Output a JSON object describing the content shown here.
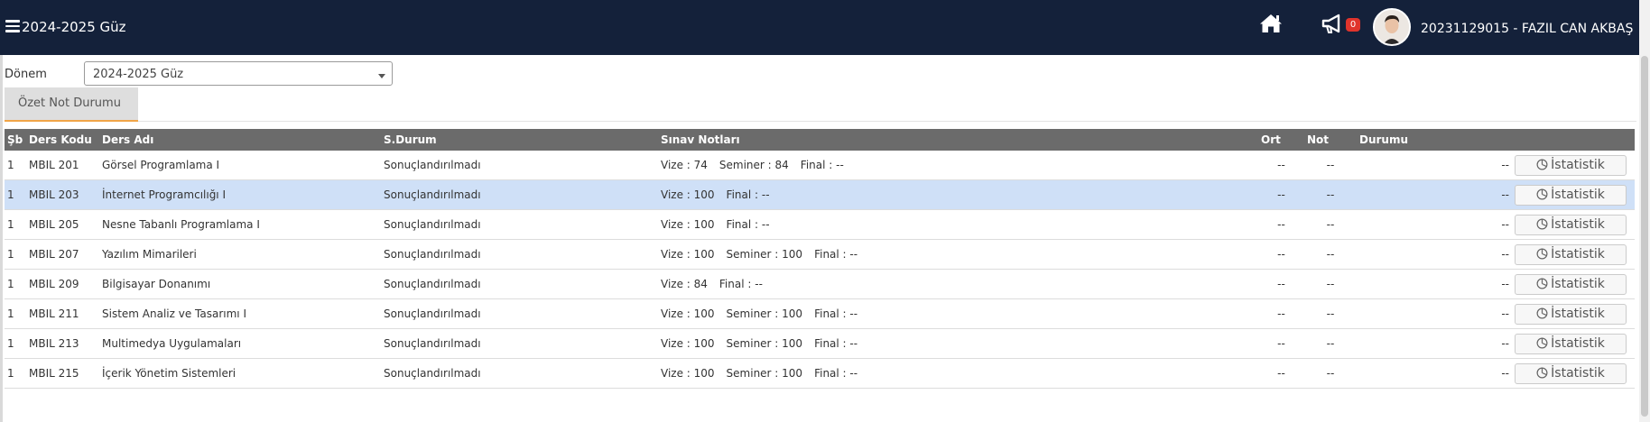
{
  "header": {
    "term": "2024-2025 Güz",
    "notification_count": "0",
    "user": "20231129015 - FAZIL CAN AKBAŞ"
  },
  "filter": {
    "label": "Dönem",
    "value": "2024-2025 Güz"
  },
  "tabs": [
    {
      "label": "Özet Not Durumu"
    }
  ],
  "table": {
    "columns": [
      "Şb",
      "Ders Kodu",
      "Ders Adı",
      "S.Durum",
      "Sınav Notları",
      "Ort",
      "Not",
      "Durumu"
    ],
    "rows": [
      {
        "sb": "1",
        "code": "MBIL 201",
        "name": "Görsel Programlama I",
        "status": "Sonuçlandırılmadı",
        "exams": [
          "Vize : 74",
          "Seminer : 84",
          "Final : --"
        ],
        "ort": "--",
        "not": "--",
        "durum": "--",
        "button": "İstatistik"
      },
      {
        "sb": "1",
        "code": "MBIL 203",
        "name": "İnternet Programcılığı I",
        "status": "Sonuçlandırılmadı",
        "exams": [
          "Vize : 100",
          "Final : --"
        ],
        "ort": "--",
        "not": "--",
        "durum": "--",
        "button": "İstatistik",
        "selected": true
      },
      {
        "sb": "1",
        "code": "MBIL 205",
        "name": "Nesne Tabanlı Programlama I",
        "status": "Sonuçlandırılmadı",
        "exams": [
          "Vize : 100",
          "Final : --"
        ],
        "ort": "--",
        "not": "--",
        "durum": "--",
        "button": "İstatistik"
      },
      {
        "sb": "1",
        "code": "MBIL 207",
        "name": "Yazılım Mimarileri",
        "status": "Sonuçlandırılmadı",
        "exams": [
          "Vize : 100",
          "Seminer : 100",
          "Final : --"
        ],
        "ort": "--",
        "not": "--",
        "durum": "--",
        "button": "İstatistik"
      },
      {
        "sb": "1",
        "code": "MBIL 209",
        "name": "Bilgisayar Donanımı",
        "status": "Sonuçlandırılmadı",
        "exams": [
          "Vize : 84",
          "Final : --"
        ],
        "ort": "--",
        "not": "--",
        "durum": "--",
        "button": "İstatistik"
      },
      {
        "sb": "1",
        "code": "MBIL 211",
        "name": "Sistem Analiz ve Tasarımı I",
        "status": "Sonuçlandırılmadı",
        "exams": [
          "Vize : 100",
          "Seminer : 100",
          "Final : --"
        ],
        "ort": "--",
        "not": "--",
        "durum": "--",
        "button": "İstatistik"
      },
      {
        "sb": "1",
        "code": "MBIL 213",
        "name": "Multimedya Uygulamaları",
        "status": "Sonuçlandırılmadı",
        "exams": [
          "Vize : 100",
          "Seminer : 100",
          "Final : --"
        ],
        "ort": "--",
        "not": "--",
        "durum": "--",
        "button": "İstatistik"
      },
      {
        "sb": "1",
        "code": "MBIL 215",
        "name": "İçerik Yönetim Sistemleri",
        "status": "Sonuçlandırılmadı",
        "exams": [
          "Vize : 100",
          "Seminer : 100",
          "Final : --"
        ],
        "ort": "--",
        "not": "--",
        "durum": "--",
        "button": "İstatistik"
      }
    ]
  },
  "icons": [
    "menu-icon",
    "home-icon",
    "megaphone-icon",
    "chart-pie-icon"
  ],
  "colors": {
    "header_bg": "#14213a",
    "status_red": "#e8161c",
    "selected_row": "#cfe0f7",
    "tab_accent": "#f0a548",
    "badge": "#e0342c"
  }
}
